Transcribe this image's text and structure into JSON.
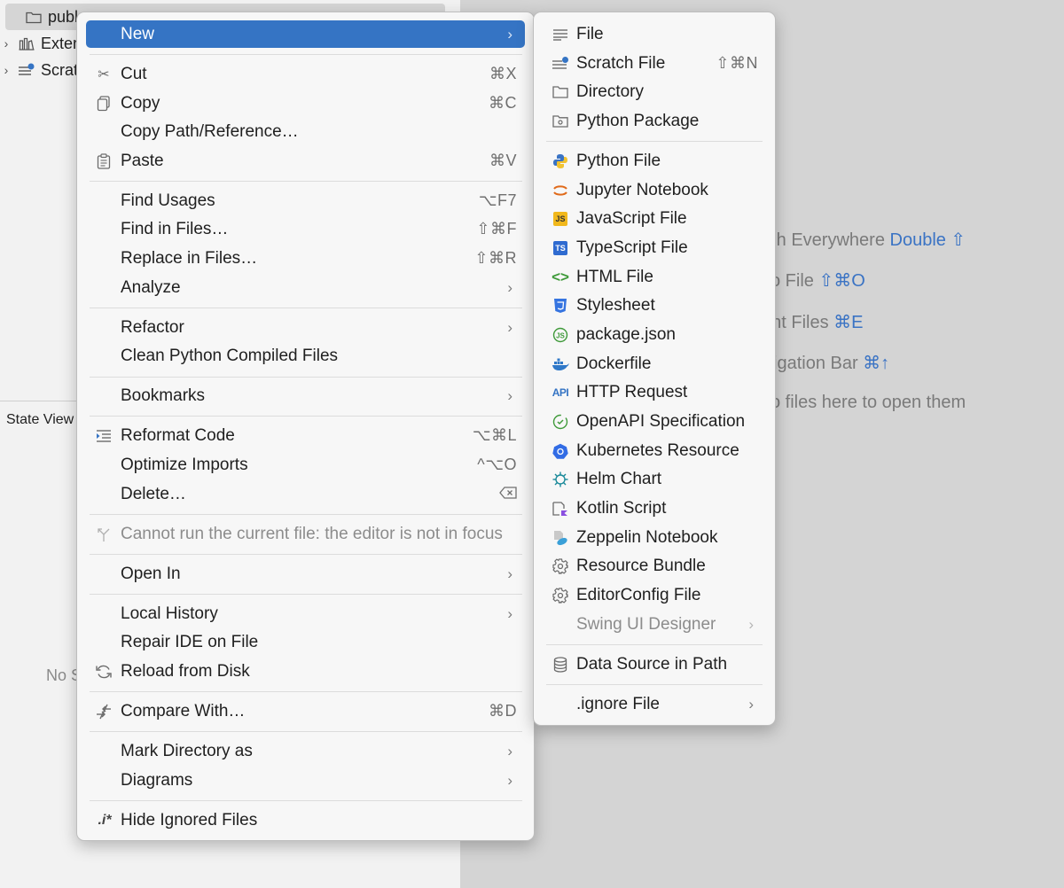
{
  "project_tree": [
    {
      "label": "publ",
      "icon": "folder-icon",
      "selected": true
    },
    {
      "label": "Exter",
      "icon": "library-icon",
      "selected": false
    },
    {
      "label": "Scrat",
      "icon": "scratch-icon",
      "selected": false
    }
  ],
  "state_view_label": "State View",
  "no_structure_text": "No S",
  "editor_hints": [
    {
      "text": "rch Everywhere ",
      "key": "Double ⇧"
    },
    {
      "text": "o File ",
      "key": "⇧⌘O"
    },
    {
      "text": "ent Files ",
      "key": "⌘E"
    },
    {
      "text": "igation Bar ",
      "key": "⌘↑"
    },
    {
      "text": "o files here to open them",
      "key": ""
    }
  ],
  "main_menu": {
    "new_label": "New",
    "cut": {
      "label": "Cut",
      "shortcut": "⌘X"
    },
    "copy": {
      "label": "Copy",
      "shortcut": "⌘C"
    },
    "copy_path": {
      "label": "Copy Path/Reference…"
    },
    "paste": {
      "label": "Paste",
      "shortcut": "⌘V"
    },
    "find_usages": {
      "label": "Find Usages",
      "shortcut": "⌥F7"
    },
    "find_in_files": {
      "label": "Find in Files…",
      "shortcut": "⇧⌘F"
    },
    "replace_in_files": {
      "label": "Replace in Files…",
      "shortcut": "⇧⌘R"
    },
    "analyze": {
      "label": "Analyze"
    },
    "refactor": {
      "label": "Refactor"
    },
    "clean_python": {
      "label": "Clean Python Compiled Files"
    },
    "bookmarks": {
      "label": "Bookmarks"
    },
    "reformat": {
      "label": "Reformat Code",
      "shortcut": "⌥⌘L"
    },
    "optimize_imports": {
      "label": "Optimize Imports",
      "shortcut": "^⌥O"
    },
    "delete": {
      "label": "Delete…"
    },
    "cannot_run": {
      "label": "Cannot run the current file: the editor is not in focus"
    },
    "open_in": {
      "label": "Open In"
    },
    "local_history": {
      "label": "Local History"
    },
    "repair_ide": {
      "label": "Repair IDE on File"
    },
    "reload": {
      "label": "Reload from Disk"
    },
    "compare": {
      "label": "Compare With…",
      "shortcut": "⌘D"
    },
    "mark_dir": {
      "label": "Mark Directory as"
    },
    "diagrams": {
      "label": "Diagrams"
    },
    "hide_ignored": {
      "label": "Hide Ignored Files",
      "icon_text": ".i*"
    }
  },
  "sub_menu": {
    "file": "File",
    "scratch_file": {
      "label": "Scratch File",
      "shortcut": "⇧⌘N"
    },
    "directory": "Directory",
    "python_package": "Python Package",
    "python_file": "Python File",
    "jupyter": "Jupyter Notebook",
    "javascript": "JavaScript File",
    "typescript": "TypeScript File",
    "html": "HTML File",
    "stylesheet": "Stylesheet",
    "package_json": "package.json",
    "dockerfile": "Dockerfile",
    "http_request": "HTTP Request",
    "openapi": "OpenAPI Specification",
    "kubernetes": "Kubernetes Resource",
    "helm": "Helm Chart",
    "kotlin_script": "Kotlin Script",
    "zeppelin": "Zeppelin Notebook",
    "resource_bundle": "Resource Bundle",
    "editorconfig": "EditorConfig File",
    "swing_ui": "Swing UI Designer",
    "data_source": "Data Source in Path",
    "ignore_file": ".ignore File"
  },
  "badges": {
    "js": "JS",
    "ts": "TS",
    "api": "API"
  },
  "colors": {
    "accent": "#3574c4",
    "menu_bg": "#f7f7f7",
    "editor_bg": "#d4d4d4"
  }
}
